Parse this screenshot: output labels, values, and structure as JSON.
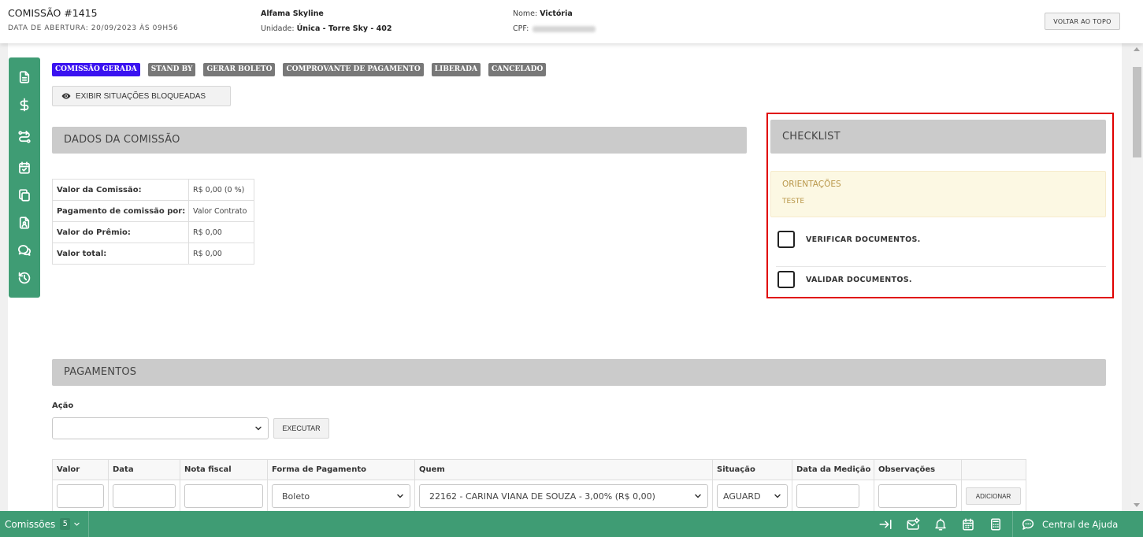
{
  "colors": {
    "green": "#3f9c74",
    "green_dark": "#368865",
    "active_tab": "#3a12f0",
    "tab_gray": "#787878",
    "panel_header": "#cbcbcb",
    "orientation_bg": "#fcf8e3",
    "orientation_text": "#b9974a",
    "highlight": "#e00000"
  },
  "header": {
    "title": "COMISSÃO #1415",
    "opened": "DATA DE ABERTURA: 20/09/2023 ÀS 09H56",
    "project": "Alfama Skyline",
    "unit_label": "Unidade:",
    "unit_value": "Única - Torre Sky - 402",
    "name_label": "Nome:",
    "name_value": "Victória",
    "cpf_label": "CPF:",
    "back_to_top": "VOLTAR AO TOPO"
  },
  "sidebar": {
    "icons": [
      "document-icon",
      "dollar-icon",
      "route-icon",
      "calendar-check-icon",
      "copy-icon",
      "contact-file-icon",
      "chat-icon",
      "history-icon"
    ]
  },
  "status_tabs": [
    {
      "label": "COMISSÃO GERADA",
      "active": true
    },
    {
      "label": "STAND BY",
      "active": false
    },
    {
      "label": "GERAR BOLETO",
      "active": false
    },
    {
      "label": "COMPROVANTE DE PAGAMENTO",
      "active": false
    },
    {
      "label": "LIBERADA",
      "active": false
    },
    {
      "label": "CANCELADO",
      "active": false
    }
  ],
  "show_blocked": {
    "icon": "eye-icon",
    "label": "EXIBIR SITUAÇÕES BLOQUEADAS"
  },
  "dados": {
    "title": "DADOS DA COMISSÃO",
    "rows": [
      {
        "label": "Valor da Comissão:",
        "value": "R$ 0,00 (0 %)"
      },
      {
        "label": "Pagamento de comissão por:",
        "value": "Valor Contrato"
      },
      {
        "label": "Valor do Prêmio:",
        "value": "R$ 0,00"
      },
      {
        "label": "Valor total:",
        "value": "R$ 0,00"
      }
    ]
  },
  "checklist": {
    "title": "CHECKLIST",
    "orientation_title": "ORIENTAÇÕES",
    "orientation_text": "TESTE",
    "items": [
      "VERIFICAR DOCUMENTOS.",
      "VALIDAR DOCUMENTOS."
    ]
  },
  "pagamentos": {
    "title": "PAGAMENTOS",
    "action_label": "Ação",
    "execute_label": "EXECUTAR",
    "columns": [
      "Valor",
      "Data",
      "Nota fiscal",
      "Forma de Pagamento",
      "Quem",
      "Situação",
      "Data da Medição",
      "Observações"
    ],
    "row": {
      "forma": "Boleto",
      "quem": "22162 - CARINA VIANA DE SOUZA - 3,00% (R$ 0,00)",
      "situacao": "AGUARD",
      "add_label": "ADICIONAR"
    }
  },
  "footer": {
    "module_label": "Comissões",
    "module_count": "5",
    "icons": [
      "arrow-right-to-bar-icon",
      "mail-settings-icon",
      "bell-icon",
      "calendar-icon",
      "calculator-icon"
    ],
    "help_icon": "chat-help-icon",
    "help_label": "Central de Ajuda"
  }
}
